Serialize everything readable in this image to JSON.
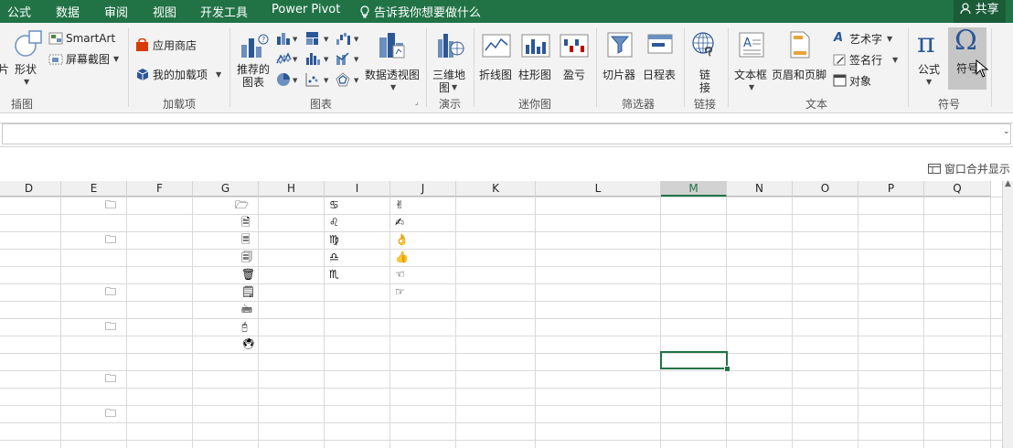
{
  "tabs": [
    "公式",
    "数据",
    "审阅",
    "视图",
    "开发工具",
    "Power Pivot"
  ],
  "tell_me": "告诉我你想要做什么",
  "share": "共享",
  "ribbon": {
    "illustrations": {
      "partial_label": "片",
      "shapes": "形状",
      "smartart": "SmartArt",
      "screenshot": "屏幕截图",
      "group": "插图"
    },
    "addins": {
      "store": "应用商店",
      "my_addins": "我的加载项",
      "group": "加载项"
    },
    "charts": {
      "recommended_line1": "推荐的",
      "recommended_line2": "图表",
      "pivot_chart": "数据透视图",
      "group": "图表"
    },
    "tours": {
      "map_line1": "三维地",
      "map_line2": "图",
      "group": "演示"
    },
    "sparklines": {
      "line": "折线图",
      "column": "柱形图",
      "winloss": "盈亏",
      "group": "迷你图"
    },
    "filters": {
      "slicer": "切片器",
      "timeline": "日程表",
      "group": "筛选器"
    },
    "links": {
      "link_line1": "链",
      "link_line2": "接",
      "group": "链接"
    },
    "text": {
      "textbox": "文本框",
      "header_footer": "页眉和页脚",
      "wordart": "艺术字",
      "signature": "签名行",
      "object": "对象",
      "group": "文本"
    },
    "symbols": {
      "equation": "公式",
      "symbol": "符号",
      "group": "符号"
    }
  },
  "window_merge": "窗口合并显示",
  "columns": [
    "D",
    "E",
    "F",
    "G",
    "H",
    "I",
    "J",
    "K",
    "L",
    "M",
    "N",
    "O",
    "P",
    "Q"
  ],
  "selected_column": "M",
  "cells": {
    "E": [
      "🗀",
      "",
      "🗀",
      "",
      "",
      "🗀",
      "",
      "🗀",
      "",
      "",
      "🗀",
      "",
      "🗀",
      ""
    ],
    "G": [
      "🗁",
      "🗎",
      "🗏",
      "🗐",
      "🗑",
      "🗒",
      "🖮",
      "🖯",
      "🖲"
    ],
    "I": [
      "♋",
      "♌",
      "♍",
      "♎",
      "♏"
    ],
    "J": [
      "✌",
      "✍",
      "👌",
      "👍",
      "☜",
      "☞"
    ]
  },
  "accent_color": "#217346"
}
